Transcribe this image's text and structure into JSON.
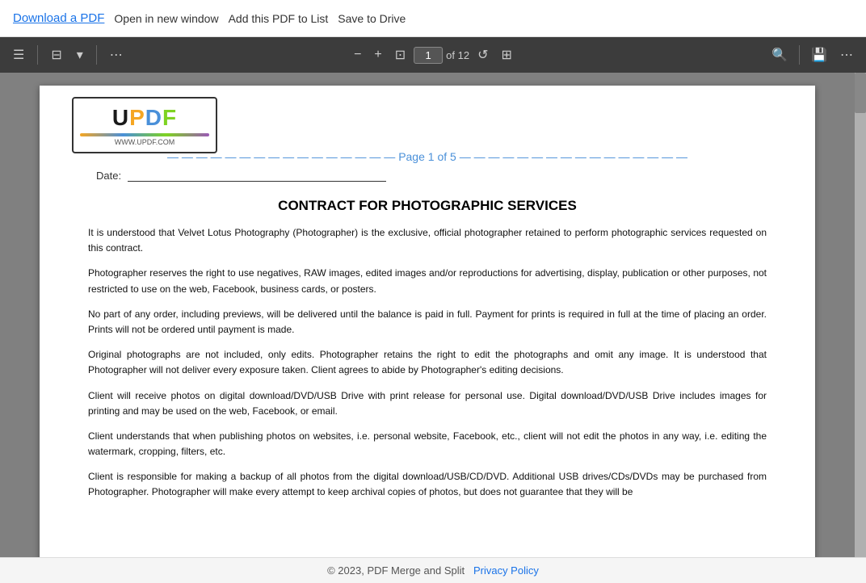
{
  "topbar": {
    "download_label": "Download a PDF",
    "open_label": "Open in new window",
    "add_label": "Add this PDF to List",
    "save_label": "Save to Drive"
  },
  "toolbar": {
    "page_current": "1",
    "page_of": "of 12",
    "zoom_icon": "↺",
    "fit_icon": "⊡",
    "search_icon": "🔍",
    "save_icon": "💾",
    "more_icon": "⋯",
    "minus_icon": "−",
    "plus_icon": "+",
    "list_icon": "≡",
    "filter_icon": "⊟",
    "chevron_icon": "▾"
  },
  "pdf": {
    "page_label": "Page 1 of 5",
    "updf_text": "UPDF",
    "updf_url": "WWW.UPDF.COM",
    "date_label": "Date:",
    "heading": "CONTRACT FOR PHOTOGRAPHIC SERVICES",
    "paragraphs": [
      "It is understood that Velvet Lotus Photography (Photographer) is the exclusive, official photographer retained to perform photographic services requested on this contract.",
      "Photographer reserves the right to use negatives, RAW images, edited images and/or reproductions for advertising, display, publication or other purposes, not restricted to use on the web, Facebook, business cards, or posters.",
      "No part of any order, including previews, will be delivered until the balance is paid in full. Payment for prints is required in full at the time of placing an order. Prints will not be ordered until payment is made.",
      "Original photographs are not included, only edits. Photographer retains the right to edit the photographs and omit any image. It is understood that Photographer will not deliver every exposure taken. Client agrees to abide by Photographer's editing decisions.",
      "Client will receive photos on digital download/DVD/USB Drive with print release for personal use. Digital download/DVD/USB Drive includes images for printing and may be used on the web, Facebook, or email.",
      "Client understands that when publishing photos on websites, i.e. personal website, Facebook, etc., client will not edit the photos in any way, i.e. editing the watermark, cropping, filters, etc.",
      "Client is responsible for making a backup of all photos from the digital download/USB/CD/DVD. Additional USB drives/CDs/DVDs may be purchased from Photographer. Photographer will make every attempt to keep archival copies of photos, but does not guarantee that they will be"
    ]
  },
  "footer": {
    "copyright": "© 2023, PDF Merge and Split",
    "privacy_label": "Privacy Policy"
  }
}
